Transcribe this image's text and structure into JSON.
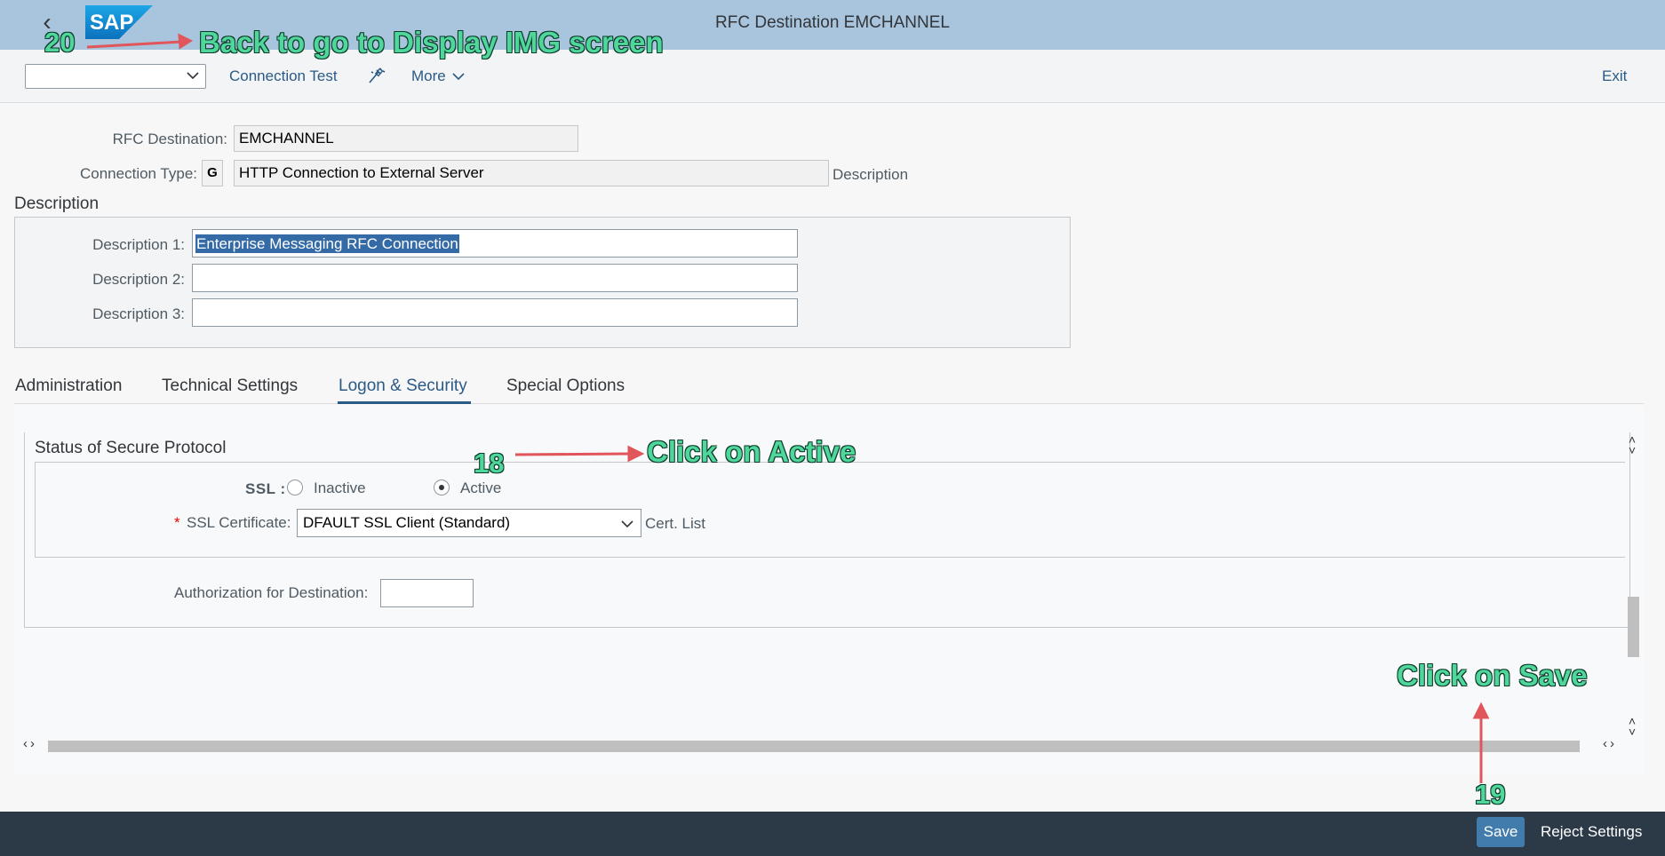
{
  "shell": {
    "title": "RFC Destination EMCHANNEL",
    "logo": "SAP"
  },
  "toolbar": {
    "select_value": "",
    "connection_test": "Connection Test",
    "more": "More",
    "exit": "Exit"
  },
  "form": {
    "rfc_destination_label": "RFC Destination:",
    "rfc_destination_value": "EMCHANNEL",
    "connection_type_label": "Connection Type:",
    "connection_type_code": "G",
    "connection_type_text": "HTTP Connection to External Server",
    "connection_type_desc": "Description"
  },
  "description": {
    "heading": "Description",
    "label1": "Description 1:",
    "value1": "Enterprise Messaging RFC Connection",
    "label2": "Description 2:",
    "value2": "",
    "label3": "Description 3:",
    "value3": ""
  },
  "tabs": [
    {
      "label": "Administration",
      "selected": false
    },
    {
      "label": "Technical Settings",
      "selected": false
    },
    {
      "label": "Logon & Security",
      "selected": true
    },
    {
      "label": "Special Options",
      "selected": false
    }
  ],
  "security": {
    "section_title": "Status of Secure Protocol",
    "ssl_label": "SSL :",
    "inactive_label": "Inactive",
    "active_label": "Active",
    "selected": "Active",
    "required_marker": "*",
    "ssl_cert_label": "SSL Certificate:",
    "ssl_cert_value": "DFAULT SSL Client (Standard)",
    "cert_list": "Cert. List",
    "auth_label": "Authorization for Destination:",
    "auth_value": ""
  },
  "footer": {
    "save": "Save",
    "reject": "Reject Settings"
  },
  "annotations": {
    "step20_num": "20",
    "step20_text": "Back to go to Display IMG screen",
    "step18_num": "18",
    "step18_text": "Click on Active",
    "step19_num": "19",
    "step19_text": "Click on Save"
  },
  "colors": {
    "shell_bg": "#a9c4dd",
    "footer_bg": "#2c3a47",
    "accent_blue": "#2c5a86",
    "save_button": "#427cac",
    "annotation_text": "#4fd69a",
    "annotation_arrow": "#e0565b"
  },
  "icons": [
    "back-icon",
    "sap-logo",
    "chevron-down-icon",
    "magic-wand-icon",
    "radio-icon",
    "scroll-arrow-icon"
  ]
}
